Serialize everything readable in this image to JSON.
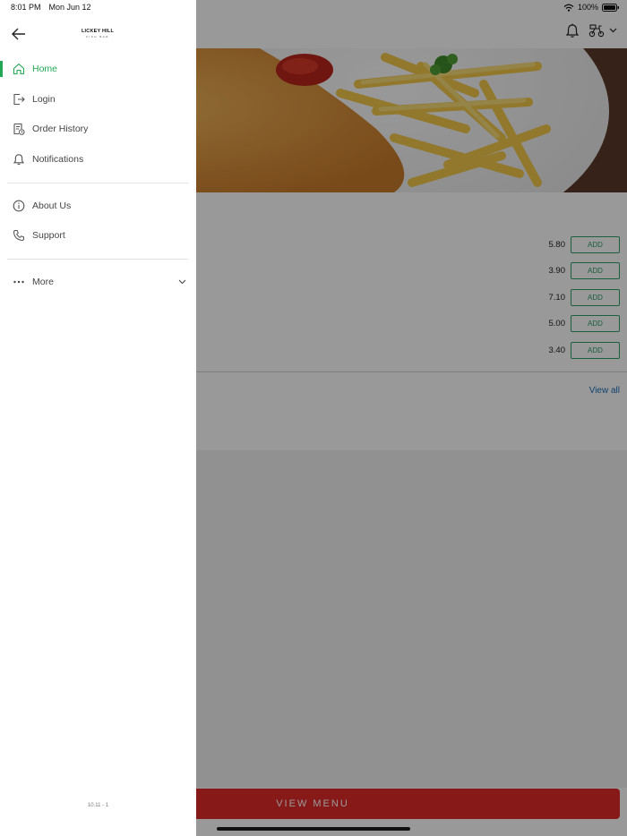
{
  "status_bar": {
    "time": "8:01 PM",
    "date": "Mon Jun 12",
    "battery": "100%"
  },
  "drawer": {
    "logo_title": "LICKEY HILL",
    "logo_subtitle": "FISH BAR",
    "nav_items": [
      {
        "label": "Home",
        "icon": "home-icon",
        "active": true
      },
      {
        "label": "Login",
        "icon": "login-icon",
        "active": false
      },
      {
        "label": "Order History",
        "icon": "order-history-icon",
        "active": false
      },
      {
        "label": "Notifications",
        "icon": "bell-icon",
        "active": false
      }
    ],
    "secondary_items": [
      {
        "label": "About Us",
        "icon": "info-icon"
      },
      {
        "label": "Support",
        "icon": "phone-icon"
      }
    ],
    "more": {
      "label": "More",
      "icon": "more-dots-icon"
    },
    "version": "10.11 - 1"
  },
  "main": {
    "items": [
      {
        "price": "5.80",
        "button": "ADD"
      },
      {
        "price": "3.90",
        "button": "ADD"
      },
      {
        "price": "7.10",
        "button": "ADD"
      },
      {
        "price": "5.00",
        "button": "ADD"
      },
      {
        "price": "3.40",
        "button": "ADD"
      }
    ],
    "view_all": "View all",
    "view_menu": "VIEW MENU"
  },
  "colors": {
    "accent_green": "#22a855",
    "add_button_green": "#2e9e6a",
    "view_menu_red": "#e22a2a",
    "link_blue": "#1e6fb8"
  }
}
